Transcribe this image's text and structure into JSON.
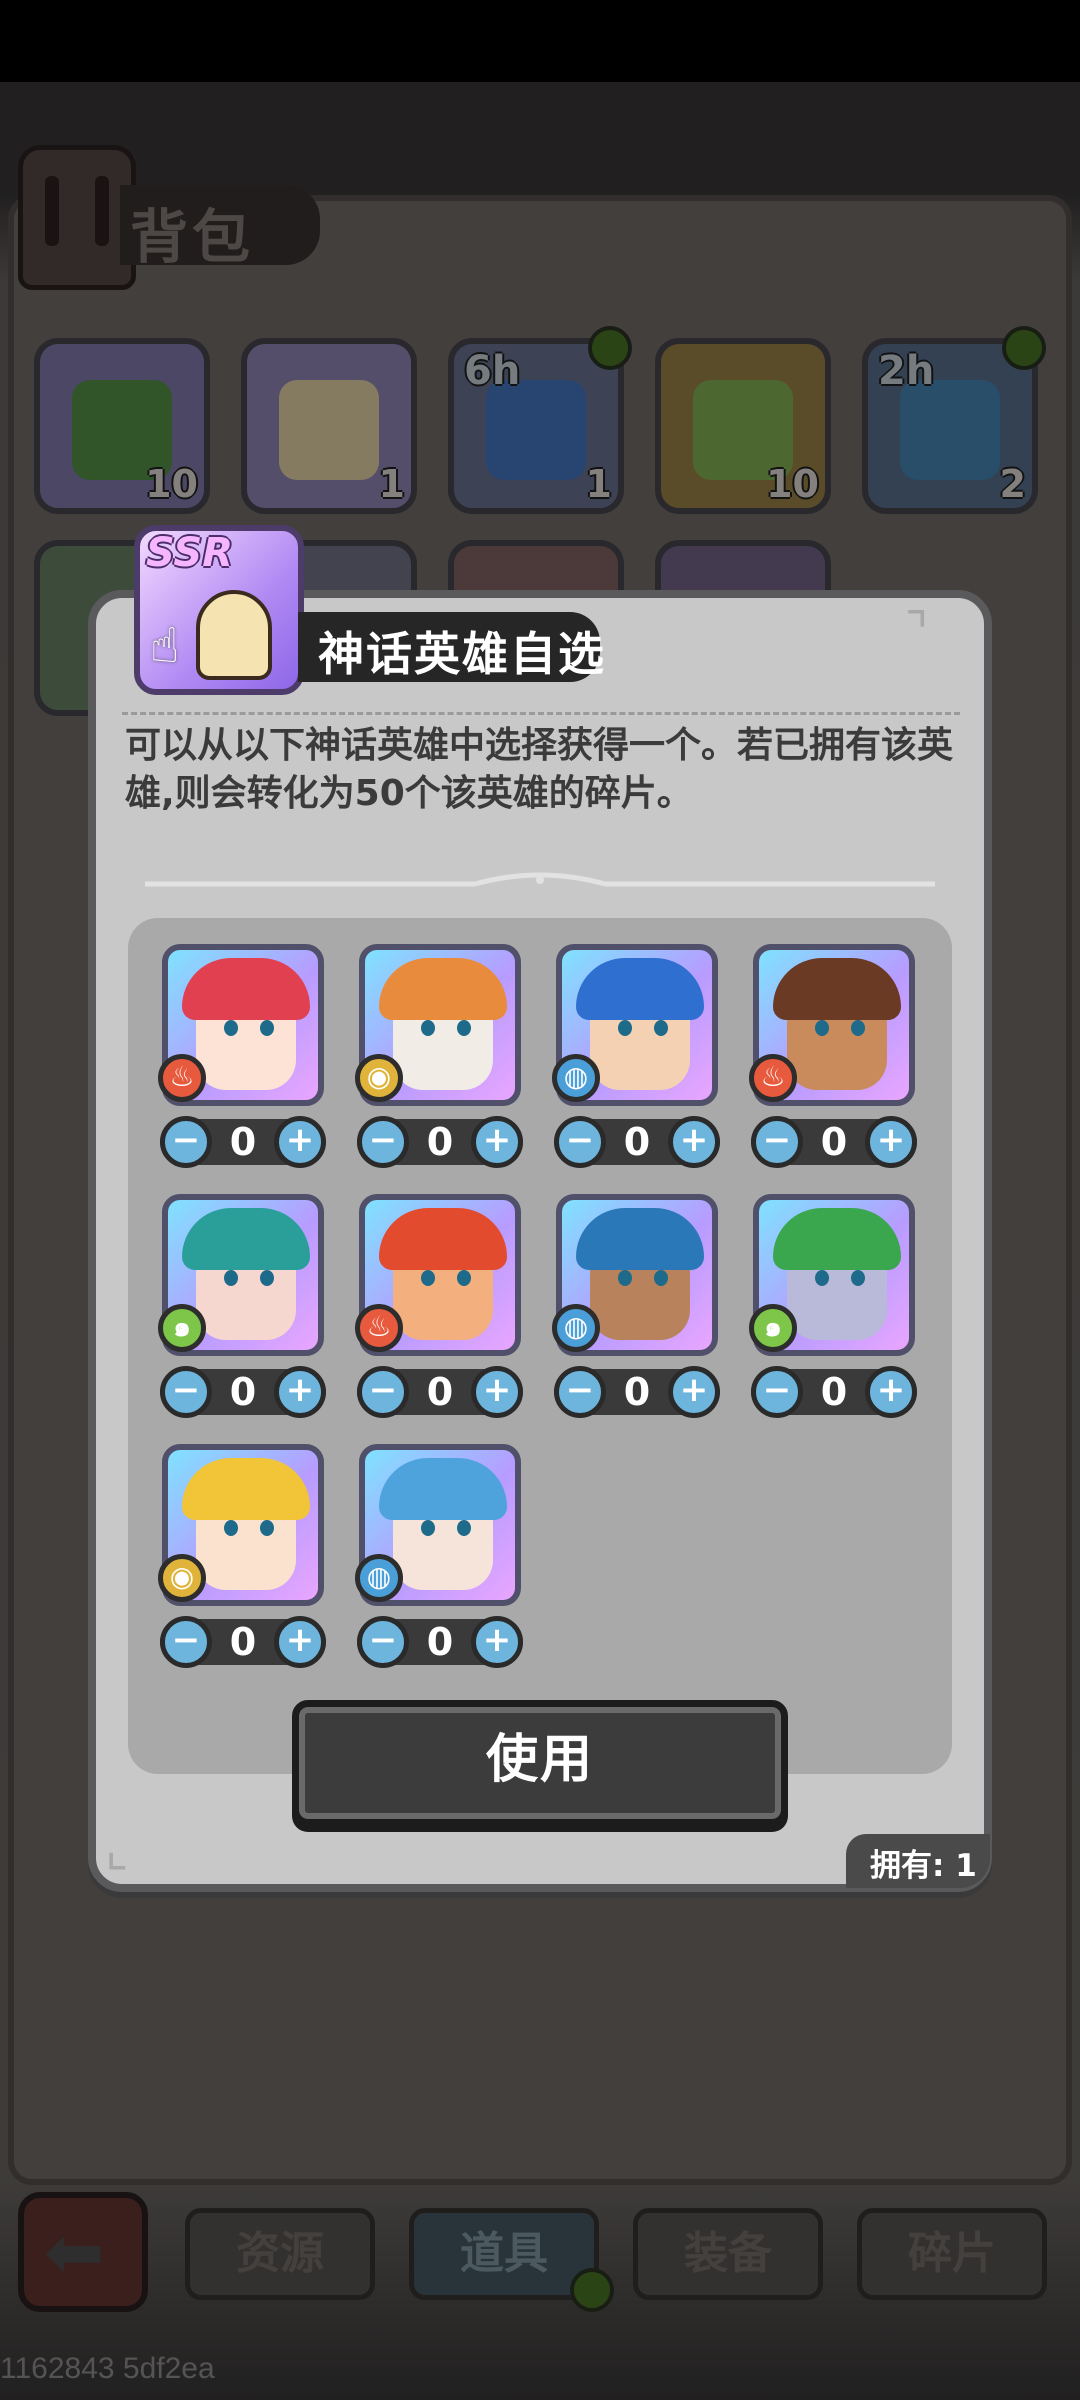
{
  "screen": {
    "title": "背包",
    "debug_build": "1162843 5df2ea"
  },
  "inventory": {
    "slots": [
      {
        "icon": "rainbow-book-icon",
        "count": "10",
        "tag": ""
      },
      {
        "icon": "ssr-hero-token-icon",
        "count": "1",
        "tag": ""
      },
      {
        "icon": "potion-6h-icon",
        "count": "1",
        "tag": "6h",
        "new": true
      },
      {
        "icon": "rainbow-book-gold-icon",
        "count": "10",
        "tag": ""
      },
      {
        "icon": "potion-2h-icon",
        "count": "2",
        "tag": "2h",
        "new": true
      }
    ]
  },
  "nav": {
    "tabs": [
      "资源",
      "道具",
      "装备",
      "碎片"
    ],
    "active_tab": "道具"
  },
  "dialog": {
    "badge": "SSR",
    "title": "神话英雄自选",
    "description": "可以从以下神话英雄中选择获得一个。若已拥有该英雄,则会转化为50个该英雄的碎片。",
    "use_label": "使用",
    "owned_label": "拥有: 1",
    "heroes": [
      {
        "element": "fire",
        "value": "0",
        "hair": "#e0404f",
        "skin": "#fde3d5"
      },
      {
        "element": "earth",
        "value": "0",
        "hair": "#e88b3c",
        "skin": "#f2ece6"
      },
      {
        "element": "water",
        "value": "0",
        "hair": "#2f6fd0",
        "skin": "#f5d1b3"
      },
      {
        "element": "fire",
        "value": "0",
        "hair": "#6b3a24",
        "skin": "#c98a5c"
      },
      {
        "element": "wind",
        "value": "0",
        "hair": "#2a9f9a",
        "skin": "#f6d7cf"
      },
      {
        "element": "fire",
        "value": "0",
        "hair": "#e24b2d",
        "skin": "#f3b07e"
      },
      {
        "element": "water",
        "value": "0",
        "hair": "#2a78b8",
        "skin": "#b8835c"
      },
      {
        "element": "wind",
        "value": "0",
        "hair": "#3aa64d",
        "skin": "#b9b9d9"
      },
      {
        "element": "earth",
        "value": "0",
        "hair": "#f2c437",
        "skin": "#fbe2cf"
      },
      {
        "element": "water",
        "value": "0",
        "hair": "#4fa3dd",
        "skin": "#f6e4da"
      }
    ]
  },
  "colors": {
    "fire": "#e85a3d",
    "earth": "#e0b43a",
    "water": "#4a9fd8",
    "wind": "#7ec64a",
    "counter_btn": "#6eb5de"
  }
}
